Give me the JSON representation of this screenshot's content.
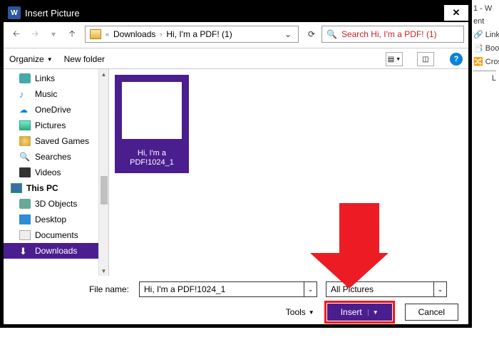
{
  "bg": {
    "l0": "1 - W",
    "l1": "ent",
    "l2": "Link",
    "l3": "Book",
    "l4": "Cross",
    "l5": "L"
  },
  "dialog": {
    "title": "Insert Picture",
    "breadcrumb": {
      "sep": "«",
      "p1": "Downloads",
      "p2": "Hi, I'm a PDF! (1)"
    },
    "search_placeholder": "Search Hi, I'm a PDF! (1)",
    "toolbar": {
      "organize": "Organize",
      "newfolder": "New folder"
    },
    "tree": [
      {
        "icon": "link",
        "label": "Links"
      },
      {
        "icon": "music",
        "label": "Music"
      },
      {
        "icon": "onedrive",
        "label": "OneDrive"
      },
      {
        "icon": "pictures",
        "label": "Pictures"
      },
      {
        "icon": "saved",
        "label": "Saved Games"
      },
      {
        "icon": "search",
        "label": "Searches"
      },
      {
        "icon": "videos",
        "label": "Videos"
      },
      {
        "icon": "pc",
        "label": "This PC"
      },
      {
        "icon": "obj",
        "label": "3D Objects"
      },
      {
        "icon": "desk",
        "label": "Desktop"
      },
      {
        "icon": "docs",
        "label": "Documents"
      },
      {
        "icon": "down",
        "label": "Downloads"
      }
    ],
    "thumb": {
      "line1": "Hi, I'm a",
      "line2": "PDF!1024_1"
    },
    "filename_label": "File name:",
    "filename_value": "Hi, I'm a PDF!1024_1",
    "filter_value": "All Pictures",
    "tools_label": "Tools",
    "insert_label": "Insert",
    "cancel_label": "Cancel"
  }
}
